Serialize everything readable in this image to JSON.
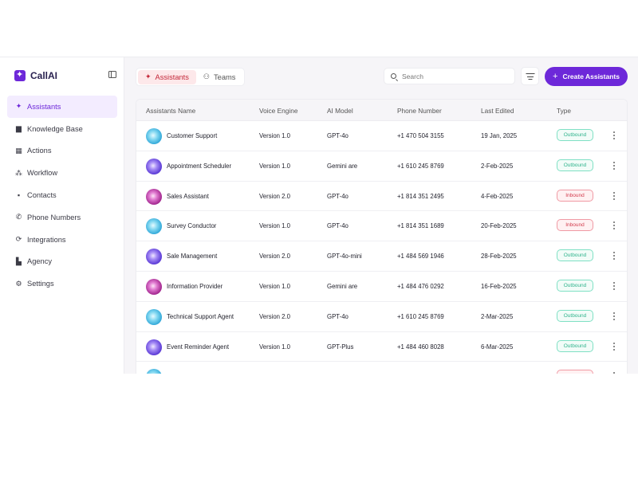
{
  "brand": {
    "name": "CallAI",
    "accent": "#6d28d9"
  },
  "sidebar": {
    "items": [
      {
        "label": "Assistants",
        "icon": "sparkle-icon",
        "active": true
      },
      {
        "label": "Knowledge Base",
        "icon": "book-icon"
      },
      {
        "label": "Actions",
        "icon": "actions-icon"
      },
      {
        "label": "Workflow",
        "icon": "workflow-icon"
      },
      {
        "label": "Contacts",
        "icon": "contacts-icon"
      },
      {
        "label": "Phone Numbers",
        "icon": "phone-icon"
      },
      {
        "label": "Integrations",
        "icon": "integrations-icon"
      },
      {
        "label": "Agency",
        "icon": "building-icon"
      },
      {
        "label": "Settings",
        "icon": "gear-icon"
      }
    ]
  },
  "tabs": [
    {
      "label": "Assistants",
      "icon": "sparkle-icon",
      "active": true
    },
    {
      "label": "Teams",
      "icon": "users-icon",
      "active": false
    }
  ],
  "search": {
    "placeholder": "Search"
  },
  "toolbar": {
    "create_label": "Create Assistants"
  },
  "table": {
    "columns": [
      "Assistants Name",
      "Voice Engine",
      "AI Model",
      "Phone Number",
      "Last Edited",
      "Type"
    ],
    "rows": [
      {
        "name": "Customer Support",
        "engine": "Version 1.0",
        "model": "GPT-4o",
        "phone": "+1 470 504 3155",
        "edited": "19 Jan, 2025",
        "type": "Outbound",
        "avatar": "blue"
      },
      {
        "name": "Appointment Scheduler",
        "engine": "Version 1.0",
        "model": "Gemini are",
        "phone": "+1 610 245 8769",
        "edited": "2-Feb-2025",
        "type": "Outbound",
        "avatar": "indigo"
      },
      {
        "name": "Sales Assistant",
        "engine": "Version 2.0",
        "model": "GPT-4o",
        "phone": "+1 814 351 2495",
        "edited": "4-Feb-2025",
        "type": "Inbound",
        "avatar": "magenta"
      },
      {
        "name": "Survey Conductor",
        "engine": "Version 1.0",
        "model": "GPT-4o",
        "phone": "+1 814 351 1689",
        "edited": "20-Feb-2025",
        "type": "Inbound",
        "avatar": "blue"
      },
      {
        "name": "Sale Management",
        "engine": "Version 2.0",
        "model": "GPT-4o-mini",
        "phone": "+1 484 569 1946",
        "edited": "28-Feb-2025",
        "type": "Outbound",
        "avatar": "indigo"
      },
      {
        "name": "Information Provider",
        "engine": "Version 1.0",
        "model": "Gemini are",
        "phone": "+1 484 476 0292",
        "edited": "16-Feb-2025",
        "type": "Outbound",
        "avatar": "magenta"
      },
      {
        "name": "Technical Support Agent",
        "engine": "Version 2.0",
        "model": "GPT-4o",
        "phone": "+1 610 245 8769",
        "edited": "2-Mar-2025",
        "type": "Outbound",
        "avatar": "blue"
      },
      {
        "name": "Event Reminder Agent",
        "engine": "Version 1.0",
        "model": "GPT-Plus",
        "phone": "+1 484 460 8028",
        "edited": "6-Mar-2025",
        "type": "Outbound",
        "avatar": "indigo"
      },
      {
        "name": "",
        "engine": "",
        "model": "",
        "phone": "",
        "edited": "",
        "type": "",
        "avatar": "blue",
        "partial": true
      }
    ]
  },
  "colors": {
    "outbound": "#2fb38c",
    "inbound": "#d23a4c",
    "active_tab_bg": "#fde8ea",
    "active_nav_bg": "#f3ecff"
  }
}
